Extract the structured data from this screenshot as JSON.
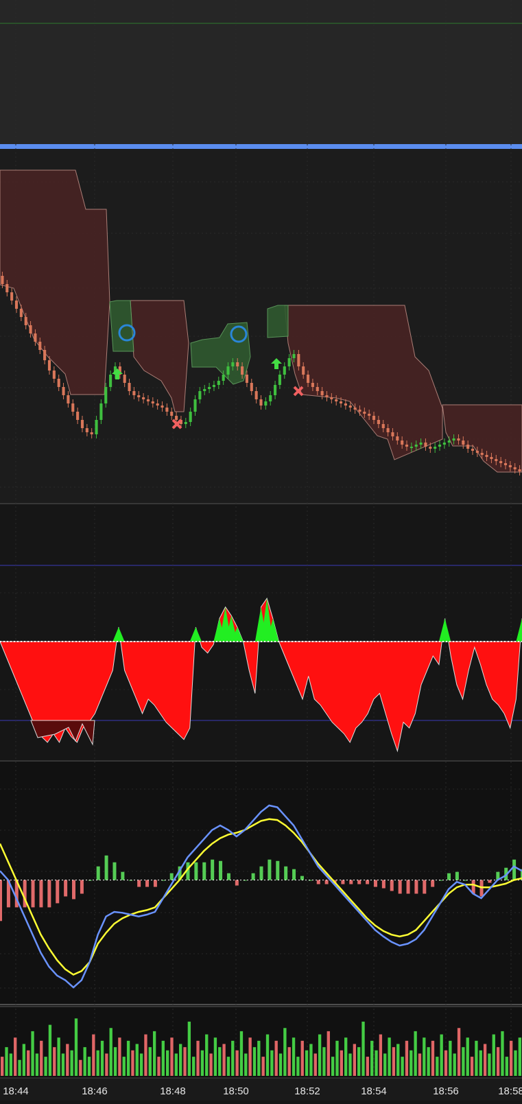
{
  "colors": {
    "top_panel_bg": "#262626",
    "panel_bg": "#1c1c1c",
    "lower_bg": "#141414",
    "separator": "#5b8def",
    "up_candle": "#3fbf3f",
    "down_candle": "#d9775a",
    "green_zone": "#2f5a2f",
    "red_zone": "#4a2424",
    "osc_up": "#22ee22",
    "osc_down": "#ff1010",
    "osc_extreme": "#5a0c0c",
    "macd_line": "#6a93ff",
    "signal_line": "#ffff33",
    "hist_up": "#55cc55",
    "hist_down": "#e06a6a",
    "vol_up": "#44cc44",
    "vol_down": "#e06666",
    "axis_text": "#e6e6e6"
  },
  "time_axis": {
    "labels": [
      "18:44",
      "18:46",
      "18:48",
      "18:50",
      "18:52",
      "18:54",
      "18:56",
      "18:58"
    ]
  },
  "chart_data": [
    {
      "type": "candlestick",
      "panel": "price",
      "x_time": [
        "18:44",
        "18:44",
        "18:44",
        "18:44",
        "18:44",
        "18:44",
        "18:44",
        "18:44",
        "18:44",
        "18:44",
        "18:45",
        "18:45",
        "18:45",
        "18:45",
        "18:45",
        "18:45",
        "18:45",
        "18:45",
        "18:45",
        "18:45",
        "18:46",
        "18:46",
        "18:46",
        "18:46",
        "18:46",
        "18:46",
        "18:46",
        "18:46",
        "18:46",
        "18:46",
        "18:47",
        "18:47",
        "18:47",
        "18:47",
        "18:47",
        "18:47",
        "18:47",
        "18:47",
        "18:47",
        "18:47",
        "18:48",
        "18:48",
        "18:48",
        "18:48",
        "18:48",
        "18:48",
        "18:48",
        "18:48",
        "18:48",
        "18:48",
        "18:49",
        "18:49",
        "18:49",
        "18:49",
        "18:49",
        "18:49",
        "18:49",
        "18:49",
        "18:49",
        "18:49",
        "18:50",
        "18:50",
        "18:50",
        "18:50",
        "18:50",
        "18:50",
        "18:50",
        "18:50",
        "18:50",
        "18:50",
        "18:51",
        "18:51",
        "18:51",
        "18:51",
        "18:51",
        "18:51",
        "18:51",
        "18:51",
        "18:51",
        "18:51",
        "18:52",
        "18:52",
        "18:52",
        "18:52",
        "18:52",
        "18:52",
        "18:52",
        "18:52",
        "18:52",
        "18:52",
        "18:53",
        "18:53",
        "18:53",
        "18:53",
        "18:53",
        "18:53",
        "18:53",
        "18:53",
        "18:53",
        "18:53",
        "18:54",
        "18:54",
        "18:54",
        "18:54",
        "18:54",
        "18:54",
        "18:54",
        "18:54",
        "18:54",
        "18:54",
        "18:55",
        "18:55",
        "18:55",
        "18:55",
        "18:55",
        "18:55",
        "18:55",
        "18:55",
        "18:55",
        "18:55",
        "18:56",
        "18:56",
        "18:56",
        "18:56",
        "18:56",
        "18:56",
        "18:56",
        "18:56",
        "18:56",
        "18:56",
        "18:57",
        "18:57",
        "18:57",
        "18:57",
        "18:57",
        "18:57",
        "18:57",
        "18:57",
        "18:57",
        "18:57",
        "18:58",
        "18:58",
        "18:58",
        "18:58",
        "18:58"
      ],
      "close": [
        46.0,
        44.0,
        42.0,
        40.0,
        38.0,
        36.0,
        34.0,
        32.0,
        30.0,
        27.5,
        25.0,
        23.0,
        21.0,
        19.0,
        17.0,
        15.0,
        13.0,
        11.0,
        10.0,
        9.5,
        13.0,
        17.0,
        21.0,
        24.0,
        26.0,
        24.0,
        22.0,
        20.0,
        19.0,
        18.5,
        18.0,
        17.5,
        17.0,
        16.5,
        16.0,
        15.0,
        14.0,
        13.0,
        12.0,
        12.5,
        15.0,
        18.0,
        20.0,
        20.5,
        21.0,
        21.5,
        22.5,
        24.0,
        26.0,
        27.0,
        26.0,
        24.0,
        22.0,
        20.0,
        18.0,
        16.5,
        17.5,
        19.0,
        21.5,
        24.0,
        26.0,
        28.0,
        29.0,
        26.0,
        24.0,
        22.0,
        21.0,
        20.0,
        19.0,
        18.5,
        18.0,
        17.5,
        17.0,
        16.5,
        16.0,
        15.5,
        15.0,
        14.5,
        14.0,
        13.0,
        12.0,
        11.0,
        10.0,
        9.0,
        8.0,
        7.0,
        6.5,
        6.5,
        7.0,
        7.5,
        6.5,
        6.0,
        6.5,
        7.0,
        7.5,
        8.0,
        8.5,
        8.0,
        7.0,
        6.0,
        5.5,
        5.0,
        4.5,
        4.0,
        3.5,
        3.0,
        2.5,
        2.0,
        1.5,
        1.0,
        0.5
      ],
      "ylim": [
        0,
        60
      ]
    },
    {
      "type": "area",
      "panel": "oscillator",
      "series": [
        {
          "values": [
            0,
            -5,
            -10,
            -15,
            -20,
            -25,
            -30,
            -33,
            -35,
            -32,
            -35,
            -30,
            -33,
            -35,
            -30,
            -28,
            -25,
            -20,
            -15,
            -10,
            5,
            -10,
            -15,
            -20,
            -25,
            -20,
            -22,
            -25,
            -28,
            -30,
            -32,
            -34,
            -30,
            5,
            -2,
            -4,
            -1,
            8,
            12,
            9,
            5,
            0,
            -10,
            -18,
            12,
            15,
            8,
            0,
            -5,
            -10,
            -15,
            -20,
            -12,
            -20,
            -22,
            -25,
            -28,
            -30,
            -32,
            -35,
            -30,
            -28,
            -25,
            -20,
            -18,
            -25,
            -32,
            -38,
            -28,
            -30,
            -25,
            -15,
            -10,
            -5,
            -8,
            8,
            -5,
            -15,
            -20,
            -10,
            -2,
            -8,
            -15,
            -20,
            -22,
            -25,
            -30,
            -20,
            8
          ]
        }
      ],
      "ylim": [
        -50,
        40
      ]
    },
    {
      "type": "line",
      "panel": "macd",
      "series": [
        {
          "values": [
            10,
            0,
            -20,
            -40,
            -60,
            -80,
            -95,
            -105,
            -110,
            -118,
            -110,
            -90,
            -60,
            -40,
            -35,
            -36,
            -38,
            -40,
            -38,
            -35,
            -20,
            -5,
            10,
            25,
            35,
            45,
            55,
            60,
            55,
            48,
            55,
            65,
            75,
            82,
            80,
            70,
            60,
            45,
            30,
            15,
            5,
            -5,
            -15,
            -25,
            -35,
            -45,
            -55,
            -62,
            -68,
            -72,
            -70,
            -65,
            -55,
            -40,
            -25,
            -10,
            -2,
            -5,
            -15,
            -20,
            -10,
            0,
            5,
            15,
            10
          ]
        },
        {
          "values": [
            40,
            20,
            0,
            -20,
            -40,
            -60,
            -75,
            -88,
            -98,
            -104,
            -100,
            -90,
            -70,
            -58,
            -48,
            -42,
            -38,
            -35,
            -33,
            -30,
            -20,
            -10,
            0,
            12,
            22,
            32,
            40,
            46,
            50,
            52,
            55,
            60,
            65,
            67,
            66,
            60,
            52,
            42,
            30,
            18,
            8,
            -2,
            -12,
            -22,
            -32,
            -42,
            -50,
            -56,
            -60,
            -62,
            -60,
            -55,
            -45,
            -35,
            -25,
            -15,
            -8,
            -5,
            -5,
            -8,
            -8,
            -6,
            -4,
            0,
            2
          ]
        }
      ],
      "ylim": [
        -130,
        100
      ]
    },
    {
      "type": "bar",
      "panel": "volume",
      "values": [
        30,
        45,
        35,
        60,
        25,
        50,
        40,
        70,
        35,
        55,
        30,
        80,
        45,
        60,
        35,
        50,
        40,
        90,
        25,
        45,
        30,
        65,
        40,
        55,
        35,
        75,
        45,
        60,
        30,
        55,
        40,
        50,
        35,
        65,
        45,
        70,
        30,
        55,
        40,
        60,
        35,
        50,
        45,
        85,
        30,
        55,
        40,
        65,
        35,
        60,
        45,
        50,
        30,
        55,
        40,
        70,
        35,
        60,
        45,
        55,
        30,
        65,
        40,
        55,
        35,
        75,
        45,
        60,
        30,
        55,
        40,
        50,
        35,
        65,
        45,
        70,
        30,
        55,
        40,
        60,
        35,
        50,
        45,
        85,
        30,
        55,
        40,
        65,
        35,
        60,
        45,
        50,
        30,
        55,
        40,
        70,
        35,
        60,
        45,
        55,
        30,
        65,
        40,
        55,
        35,
        75,
        45,
        60,
        30,
        55,
        40,
        50,
        35,
        65,
        45,
        70,
        30,
        55,
        40,
        60
      ],
      "ylim": [
        0,
        100
      ]
    }
  ]
}
